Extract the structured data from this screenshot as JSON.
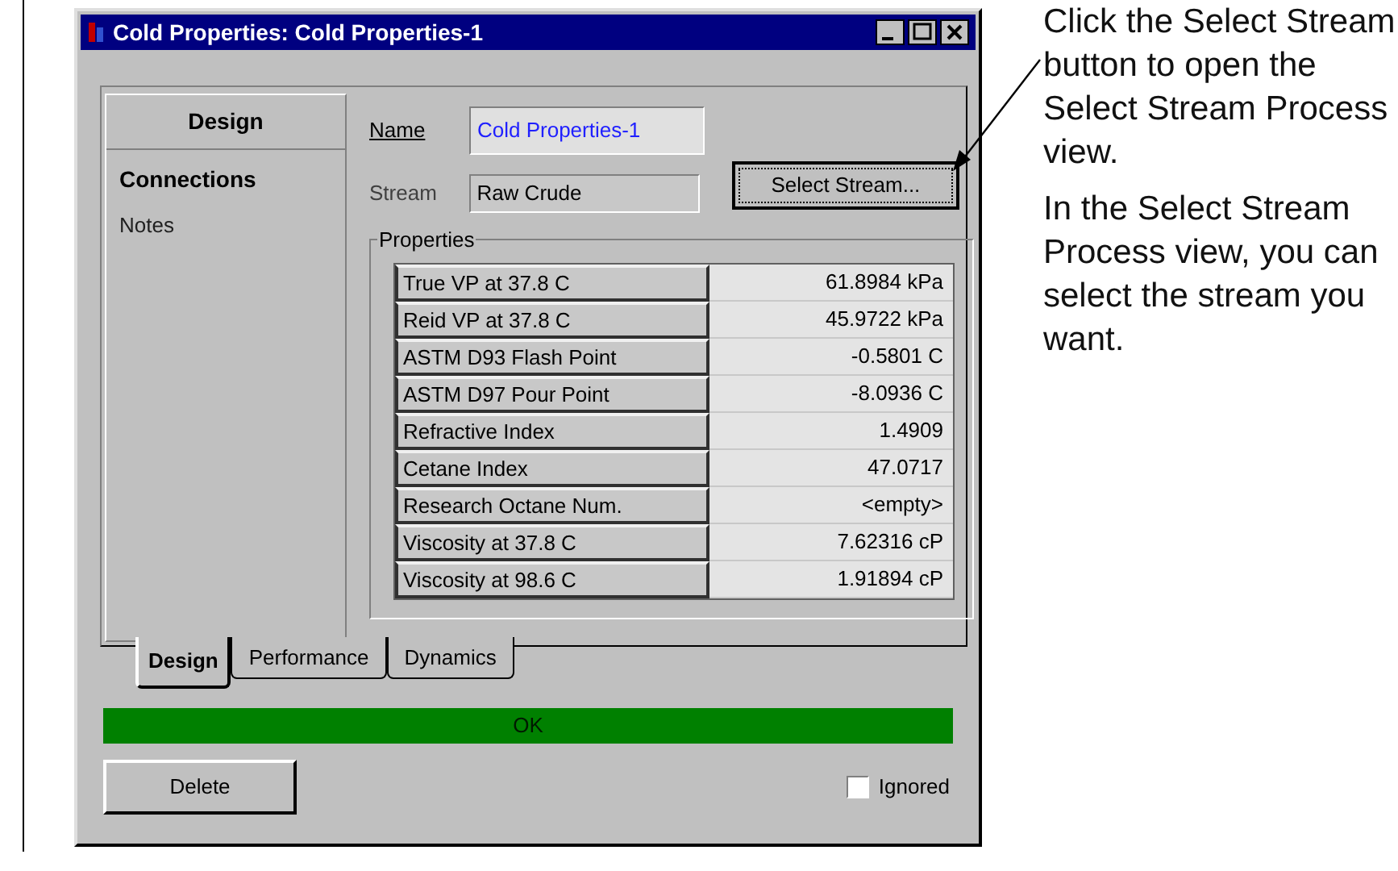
{
  "window": {
    "title": "Cold Properties: Cold Properties-1"
  },
  "sidebar": {
    "header": "Design",
    "items": [
      {
        "label": "Connections",
        "selected": true
      },
      {
        "label": "Notes",
        "selected": false
      }
    ]
  },
  "name_field": {
    "label": "Name",
    "value": "Cold Properties-1"
  },
  "stream_field": {
    "label": "Stream",
    "value": "Raw Crude"
  },
  "select_button": "Select Stream...",
  "properties": {
    "title": "Properties",
    "rows": [
      {
        "label": "True VP at 37.8 C",
        "value": "61.8984 kPa"
      },
      {
        "label": "Reid VP at 37.8 C",
        "value": "45.9722 kPa"
      },
      {
        "label": "ASTM D93 Flash Point",
        "value": "-0.5801 C"
      },
      {
        "label": "ASTM D97 Pour Point",
        "value": "-8.0936 C"
      },
      {
        "label": "Refractive Index",
        "value": "1.4909"
      },
      {
        "label": "Cetane Index",
        "value": "47.0717"
      },
      {
        "label": "Research Octane Num.",
        "value": "<empty>"
      },
      {
        "label": "Viscosity at 37.8 C",
        "value": "7.62316 cP"
      },
      {
        "label": "Viscosity at 98.6 C",
        "value": "1.91894 cP"
      }
    ]
  },
  "tabs": [
    {
      "label": "Design",
      "selected": true
    },
    {
      "label": "Performance",
      "selected": false
    },
    {
      "label": "Dynamics",
      "selected": false
    }
  ],
  "status": {
    "text": "OK",
    "color": "#008000"
  },
  "delete_button": "Delete",
  "ignored": {
    "label": "Ignored",
    "checked": false
  },
  "callout": [
    "Click the Select Stream button to open the Select Stream Process view.",
    "In the Select Stream Process view, you can select the stream you want."
  ]
}
